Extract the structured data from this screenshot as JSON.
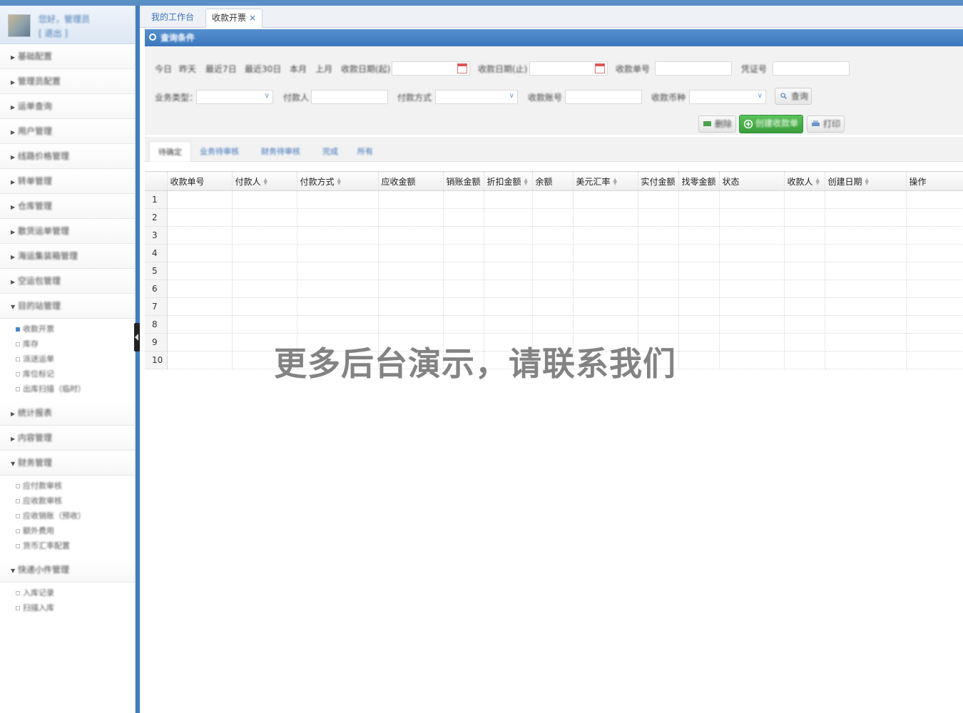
{
  "sidebar": {
    "user_greeting": "您好，管理员",
    "user_logout": "[ 退出 ]",
    "menu": [
      {
        "label": "基础配置",
        "expanded": false
      },
      {
        "label": "管理员配置",
        "expanded": false
      },
      {
        "label": "运单查询",
        "expanded": false
      },
      {
        "label": "用户管理",
        "expanded": false
      },
      {
        "label": "线路价格管理",
        "expanded": false
      },
      {
        "label": "转单管理",
        "expanded": false
      },
      {
        "label": "仓库管理",
        "expanded": false
      },
      {
        "label": "散货运单管理",
        "expanded": false
      },
      {
        "label": "海运集装箱管理",
        "expanded": false
      },
      {
        "label": "空运包管理",
        "expanded": false
      },
      {
        "label": "目的站管理",
        "expanded": true,
        "children": [
          "收款开票",
          "库存",
          "派送运单",
          "库位标记",
          "出库扫描（临时）"
        ]
      },
      {
        "label": "统计报表",
        "expanded": false
      },
      {
        "label": "内容管理",
        "expanded": false
      },
      {
        "label": "财务管理",
        "expanded": true,
        "children": [
          "应付款审核",
          "应收款审核",
          "应收销账（预收）",
          "额外费用",
          "货币汇率配置"
        ]
      },
      {
        "label": "快递小件管理",
        "expanded": true,
        "children": [
          "入库记录",
          "扫描入库"
        ]
      }
    ]
  },
  "tabs": {
    "home": "我的工作台",
    "active": "收款开票",
    "close": "×"
  },
  "panel": {
    "title": "查询条件"
  },
  "filters": {
    "quick_dates": [
      "今日",
      "昨天",
      "最近7日",
      "最近30日",
      "本月",
      "上月"
    ],
    "date_from_label": "收款日期(起)",
    "date_to_label": "收款日期(止)",
    "receipt_no_label": "收款单号",
    "voucher_label": "凭证号",
    "business_type_label": "业务类型：",
    "payer_label": "付款人",
    "pay_method_label": "付款方式",
    "account_label": "收款账号",
    "currency_label": "收款币种",
    "search_button": "查询",
    "delete_button": "删除",
    "create_button": "创建收款单",
    "print_button": "打印"
  },
  "subtabs": [
    "待确定",
    "业务待审核",
    "财务待审核",
    "完成",
    "所有"
  ],
  "table": {
    "columns": [
      "收款单号",
      "付款人",
      "付款方式",
      "应收金额",
      "销账金额",
      "折扣金额",
      "余额",
      "美元汇率",
      "实付金额",
      "找零金额",
      "状态",
      "收款人",
      "创建日期",
      "操作"
    ],
    "sortable": [
      false,
      true,
      true,
      false,
      false,
      true,
      false,
      true,
      false,
      false,
      false,
      true,
      true,
      false
    ],
    "row_numbers": [
      "1",
      "2",
      "3",
      "4",
      "5",
      "6",
      "7",
      "8",
      "9",
      "10"
    ]
  },
  "watermark": "更多后台演示，请联系我们"
}
